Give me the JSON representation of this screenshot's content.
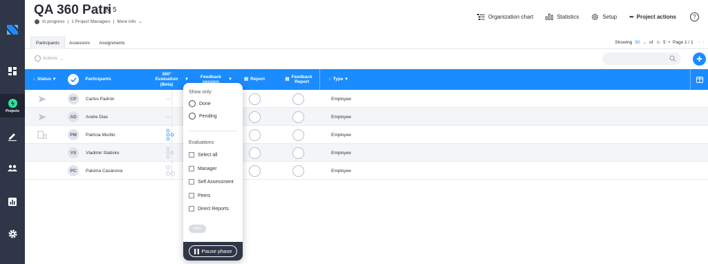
{
  "project": {
    "title": "QA 360 Patri",
    "participants_count": "5",
    "status": "In progress",
    "managers": "1 Project Managers",
    "more_info": "More info"
  },
  "top_actions": [
    {
      "label": "Organization chart",
      "icon": "org-chart-icon"
    },
    {
      "label": "Statistics",
      "icon": "statistics-icon"
    },
    {
      "label": "Setup",
      "icon": "gear-icon"
    },
    {
      "label": "Project actions",
      "icon": "more-icon"
    }
  ],
  "help": "?",
  "sidebar": {
    "active_label": "Projects",
    "items": [
      "dashboard-icon",
      "projects-icon",
      "edit-icon",
      "users-icon",
      "reports-icon",
      "settings-icon"
    ]
  },
  "tabs": [
    "Participants",
    "Assessors",
    "Assignments"
  ],
  "pager": {
    "showing_label": "Showing",
    "per_page": "50",
    "of_label": "of",
    "total": "5",
    "page_label": "Page 1 / 1"
  },
  "toolbar": {
    "actions_label": "Actions"
  },
  "table": {
    "headers": {
      "status": "Status",
      "participants": "Participants",
      "evaluation_l1": "360°",
      "evaluation_l2": "Evaluation",
      "evaluation_l3": "(Beta)",
      "feedback_session_l1": "Feedback",
      "feedback_session_l2": "session",
      "report": "Report",
      "feedback_report_l1": "Feedback",
      "feedback_report_l2": "Report",
      "type": "Type"
    },
    "rows": [
      {
        "initials": "CP",
        "name": "Carlos Padrón",
        "evaluation": "—",
        "type": "Employee"
      },
      {
        "initials": "AD",
        "name": "Andre Dias",
        "evaluation": "—",
        "type": "Employee"
      },
      {
        "initials": "PM",
        "name": "Patricia Murillo",
        "evaluation": "",
        "type": "Employee"
      },
      {
        "initials": "VS",
        "name": "Vladimir Stativko",
        "evaluation": "",
        "type": "Employee"
      },
      {
        "initials": "PC",
        "name": "Paloma Casanova",
        "evaluation": "",
        "type": "Employee"
      }
    ]
  },
  "popover": {
    "show_only_label": "Show only:",
    "radios": [
      "Done",
      "Pending"
    ],
    "evaluations_label": "Evaluations",
    "checkboxes": [
      "Select all",
      "Manager",
      "Self Assessment",
      "Peers",
      "Direct Reports"
    ],
    "filter_label": "Filter",
    "pause_label": "Pause phase"
  },
  "colors": {
    "accent": "#1a8cff",
    "sidebar": "#2f3647",
    "active_sidebar": "#1f2533",
    "row_alt": "#f3f5f8"
  }
}
